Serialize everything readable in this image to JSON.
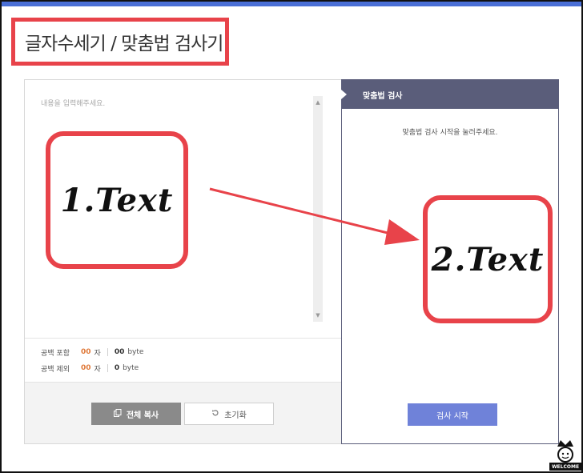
{
  "page_title": "글자수세기 / 맞춤법 검사기",
  "editor": {
    "placeholder": "내용을 입력해주세요.",
    "scroll_up": "▲",
    "scroll_down": "▼",
    "counts": [
      {
        "label": "공백 포함",
        "chars": "00",
        "char_unit": "자",
        "bytes": "00",
        "byte_unit": "byte"
      },
      {
        "label": "공백 제외",
        "chars": "00",
        "char_unit": "자",
        "bytes": "0",
        "byte_unit": "byte"
      }
    ],
    "copy_button": "전체 복사",
    "reset_button": "초기화",
    "copy_icon": "copy-icon",
    "reset_icon": "refresh-icon"
  },
  "result": {
    "header": "맞춤법 검사",
    "message": "맞춤법 검사 시작을 눌러주세요.",
    "check_button": "검사 시작"
  },
  "annotations": {
    "box1": "1.Text",
    "box2": "2.Text"
  },
  "logo": {
    "text": "WELCOME"
  },
  "colors": {
    "accent_bar": "#4a6fd6",
    "annotation_red": "#e8434a",
    "header_bg": "#5a5d7a",
    "check_button": "#6f82d9",
    "count_orange": "#e07a3a"
  }
}
